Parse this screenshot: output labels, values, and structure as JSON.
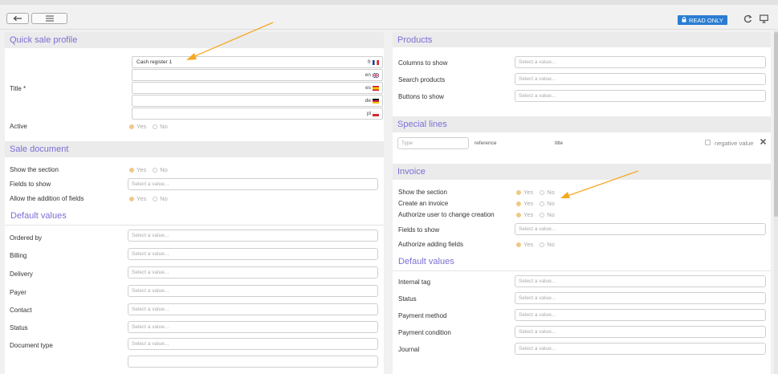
{
  "toolbar": {
    "back_icon": "back-arrow-icon",
    "list_icon": "list-icon",
    "read_only": "READ ONLY",
    "refresh_icon": "refresh-icon",
    "screen_icon": "monitor-icon"
  },
  "colors": {
    "accent": "#7a6fd6",
    "badge": "#2a7dd2",
    "annotation": "#f7a823",
    "radio_on": "#f0c886"
  },
  "placeholder": "Select a value...",
  "left": {
    "quick_sale": {
      "heading": "Quick sale profile",
      "title_label": "Title *",
      "title_values": [
        {
          "text": "Cash register 1",
          "code": "fr"
        },
        {
          "text": "",
          "code": "en"
        },
        {
          "text": "",
          "code": "es"
        },
        {
          "text": "",
          "code": "de"
        },
        {
          "text": "",
          "code": "pl"
        }
      ],
      "active_label": "Active",
      "active_yes": "Yes",
      "active_no": "No"
    },
    "sale_document": {
      "heading": "Sale document",
      "show_section": "Show the section",
      "fields_to_show": "Fields to show",
      "allow_fields": "Allow the addition of fields",
      "yes": "Yes",
      "no": "No",
      "default_values": "Default values",
      "defaults": [
        "Ordered by",
        "Billing",
        "Delivery",
        "Payer",
        "Contact",
        "Status",
        "Document type"
      ]
    }
  },
  "right": {
    "products": {
      "heading": "Products",
      "rows": [
        "Columns to show",
        "Search products",
        "Buttons to show"
      ]
    },
    "special_lines": {
      "heading": "Special lines",
      "type_placeholder": "Type",
      "reference": "reference",
      "title": "title",
      "negative": "negative value"
    },
    "invoice": {
      "heading": "Invoice",
      "show_section": "Show the section",
      "create_invoice": "Create an invoice",
      "authorize_change": "Authorize user to change creation",
      "fields_to_show": "Fields to show",
      "authorize_fields": "Authorize adding fields",
      "yes": "Yes",
      "no": "No",
      "default_values": "Default values",
      "defaults": [
        "Internal tag",
        "Status",
        "Payment method",
        "Payment condition",
        "Journal"
      ]
    }
  }
}
